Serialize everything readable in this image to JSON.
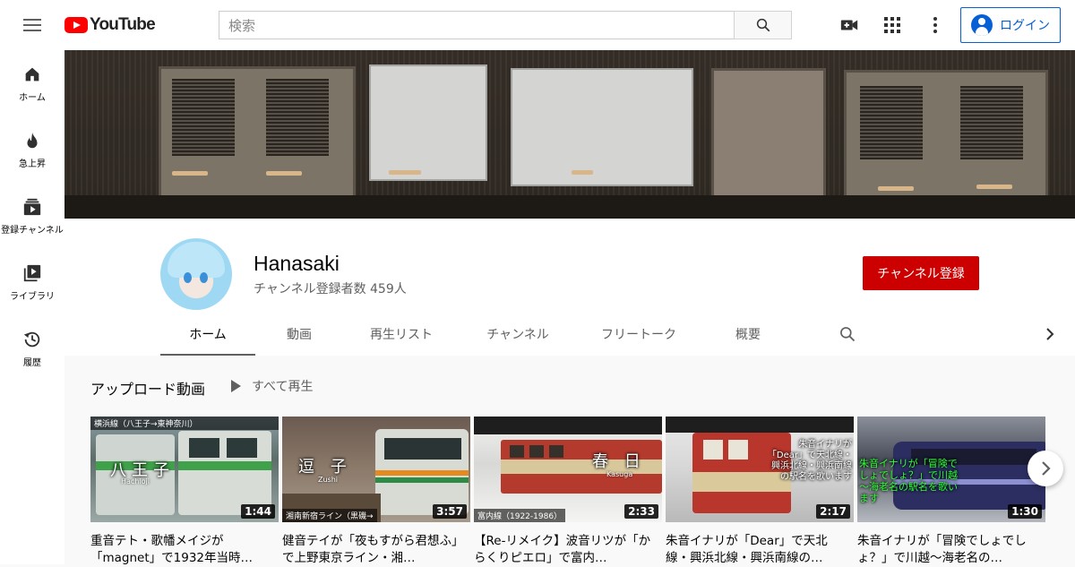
{
  "header": {
    "logo_text": "YouTube",
    "search_placeholder": "検索",
    "login_label": "ログイン",
    "icons": [
      "menu-icon",
      "create-video-icon",
      "apps-icon",
      "more-vert-icon",
      "search-icon",
      "account-circle-icon"
    ]
  },
  "sidebar": {
    "items": [
      {
        "label": "ホーム",
        "icon": "home-icon"
      },
      {
        "label": "急上昇",
        "icon": "flame-icon"
      },
      {
        "label": "登録チャンネル",
        "icon": "subscriptions-icon"
      },
      {
        "label": "ライブラリ",
        "icon": "library-icon"
      },
      {
        "label": "履歴",
        "icon": "history-icon"
      }
    ]
  },
  "channel": {
    "name": "Hanasaki",
    "subscribers": "チャンネル登録者数 459人",
    "subscribe_label": "チャンネル登録",
    "tabs": [
      "ホーム",
      "動画",
      "再生リスト",
      "チャンネル",
      "フリートーク",
      "概要"
    ],
    "active_tab": "ホーム"
  },
  "uploads": {
    "title": "アップロード動画",
    "play_all": "すべて再生",
    "videos": [
      {
        "title": "重音テト・歌幡メイジが「magnet」で1932年当時…",
        "duration": "1:44",
        "thumb_top": "横浜線（八王子→東神奈川）",
        "thumb_caption": "八王子",
        "thumb_sub": "Hachioji"
      },
      {
        "title": "健音テイが「夜もすがら君想ふ」で上野東京ライン・湘…",
        "duration": "3:57",
        "thumb_caption": "逗 子",
        "thumb_sub": "Zushi",
        "thumb_bottom": "湘南新宿ライン（黒磯→"
      },
      {
        "title": "【Re-リメイク】波音リツが「からくりピエロ」で富内…",
        "duration": "2:33",
        "thumb_caption": "春 日",
        "thumb_sub": "Kasuga",
        "thumb_bottom": "富内線（1922-1986）"
      },
      {
        "title": "朱音イナリが「Dear」で天北線・興浜北線・興浜南線の…",
        "duration": "2:17",
        "thumb_caption": "朱音イナリが「Dear」で天北線・興浜北線・興浜南線の駅名を歌います"
      },
      {
        "title": "朱音イナリが「冒険でしょでしょ？」で川越～海老名の…",
        "duration": "1:30",
        "thumb_caption": "朱音イナリが「冒険でしょでしょ？」で川越～海老名の駅名を歌います"
      }
    ]
  },
  "colors": {
    "brand_red": "#ff0000",
    "subscribe_red": "#cc0000",
    "link_blue": "#065fd4",
    "background": "#f9f9f9"
  }
}
